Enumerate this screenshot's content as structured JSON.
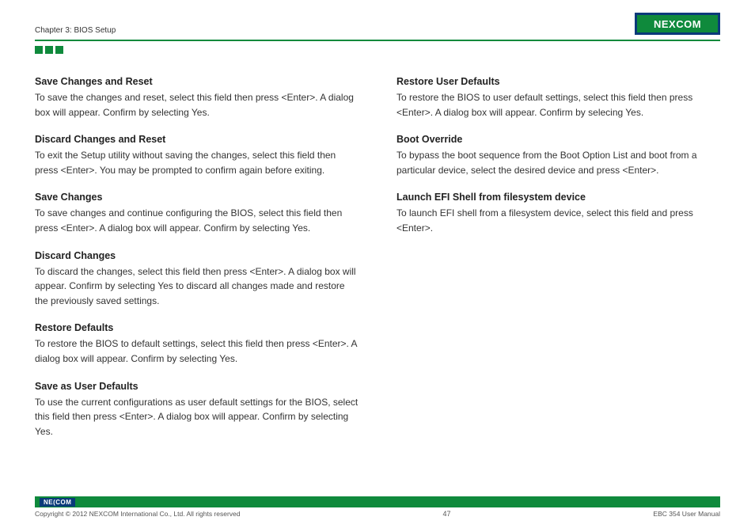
{
  "header": {
    "chapter": "Chapter 3: BIOS Setup",
    "logo_text": "NEXCOM"
  },
  "left_column": [
    {
      "title": "Save Changes and Reset",
      "body": "To save the changes and reset, select this field then press <Enter>. A dialog box will appear. Confirm by selecting Yes."
    },
    {
      "title": "Discard Changes and Reset",
      "body": "To exit the Setup utility without saving the changes, select this field then press <Enter>. You may be prompted to confirm again before exiting."
    },
    {
      "title": "Save Changes",
      "body": "To save changes and continue configuring the BIOS, select this field then press <Enter>. A dialog box will appear. Confirm by selecting Yes."
    },
    {
      "title": "Discard Changes",
      "body": "To discard the changes, select this field then press <Enter>. A dialog box will appear. Confirm by selecting Yes to discard all changes made and restore the previously saved settings."
    },
    {
      "title": "Restore Defaults",
      "body": "To restore the BIOS to default settings, select this field then press <Enter>. A dialog box will appear. Confirm by selecting Yes."
    },
    {
      "title": "Save as User Defaults",
      "body": "To use the current configurations as user default settings for the BIOS, select this field then press <Enter>. A dialog box will appear. Confirm by selecting Yes."
    }
  ],
  "right_column": [
    {
      "title": "Restore User Defaults",
      "body": "To restore the BIOS to user default settings, select this field then press <Enter>. A dialog box will appear. Confirm by selecing Yes."
    },
    {
      "title": "Boot Override",
      "body": "To bypass the boot sequence from the Boot Option List and boot from a particular device, select the desired device and press <Enter>."
    },
    {
      "title": "Launch EFI Shell from filesystem device",
      "body": "To launch EFI shell from a filesystem device, select this field and press <Enter>."
    }
  ],
  "footer": {
    "logo_text": "NE(COM",
    "copyright": "Copyright © 2012 NEXCOM International Co., Ltd. All rights reserved",
    "page": "47",
    "manual": "EBC 354 User Manual"
  }
}
